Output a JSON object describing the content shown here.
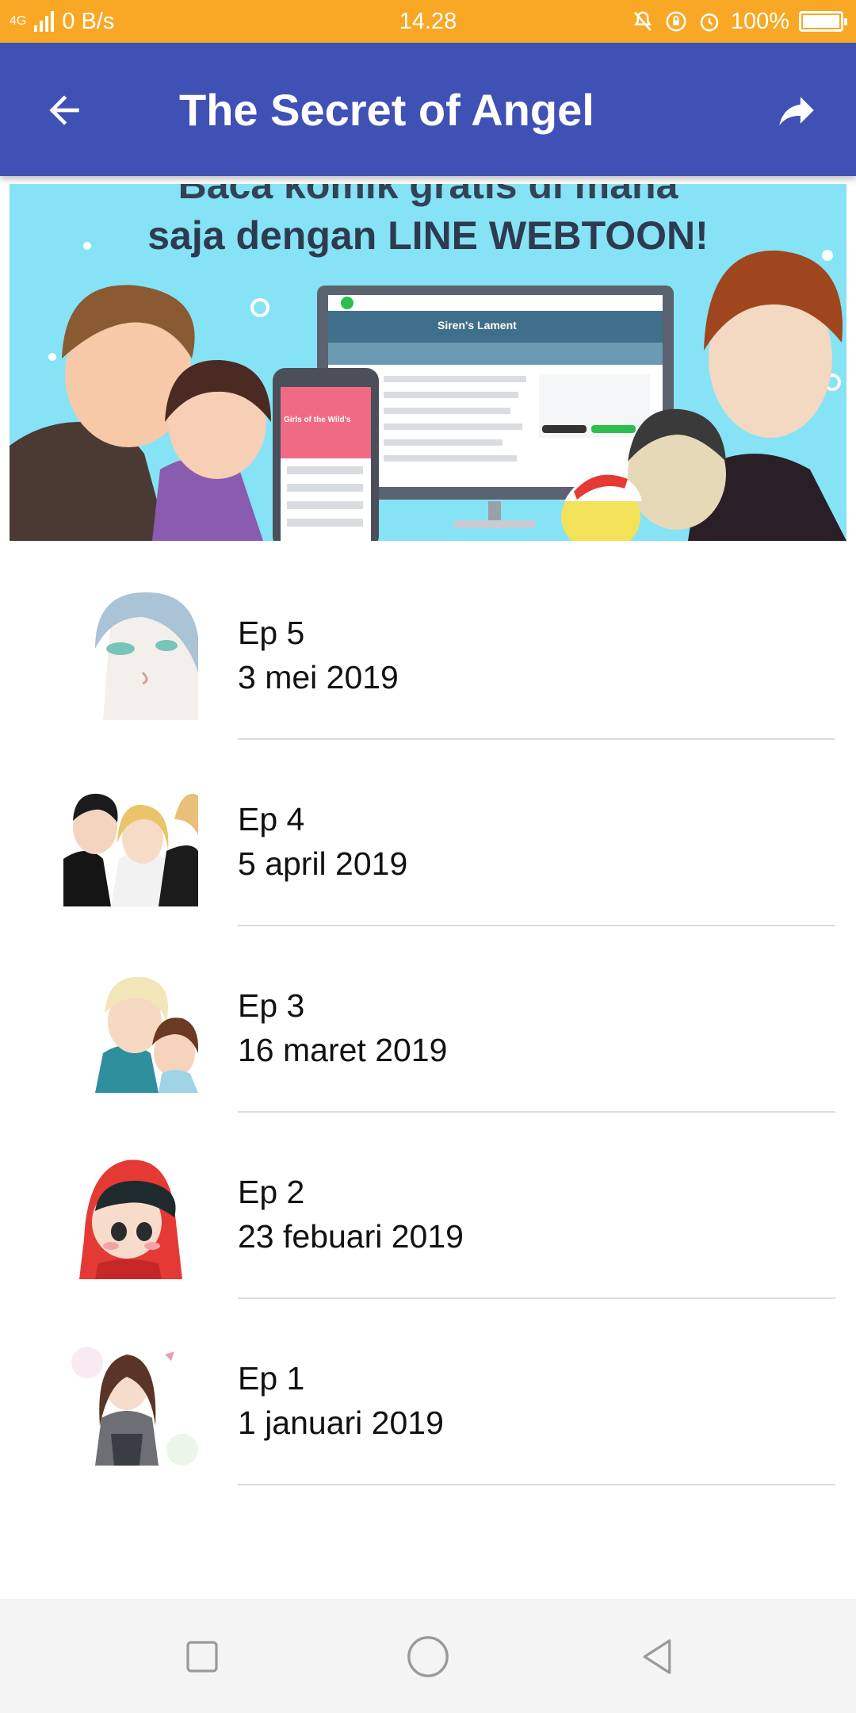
{
  "status_bar": {
    "network": "4G",
    "speed": "0 B/s",
    "time": "14.28",
    "battery": "100%",
    "battery_level": 1.0,
    "icons": [
      "mute-icon",
      "rotation-lock-icon",
      "alarm-icon",
      "battery-icon"
    ]
  },
  "app_bar": {
    "title": "The Secret of Angel",
    "back_icon": "arrow-back-icon",
    "share_icon": "share-icon",
    "color": "#3f51b5"
  },
  "banner": {
    "line1": "Baca komik gratis di mana",
    "line2": "saja dengan LINE WEBTOON!",
    "inner_labels": {
      "series": "Siren's Lament",
      "phone_title": "Girls of the Wild's"
    }
  },
  "episodes": [
    {
      "title": "Ep 5",
      "date": "3 mei 2019"
    },
    {
      "title": "Ep 4",
      "date": "5 april 2019"
    },
    {
      "title": "Ep 3",
      "date": "16 maret 2019"
    },
    {
      "title": "Ep 2",
      "date": "23 febuari 2019"
    },
    {
      "title": "Ep 1",
      "date": "1 januari 2019"
    }
  ],
  "nav_bar": {
    "icons": [
      "recent-apps-icon",
      "home-icon",
      "back-icon"
    ]
  }
}
